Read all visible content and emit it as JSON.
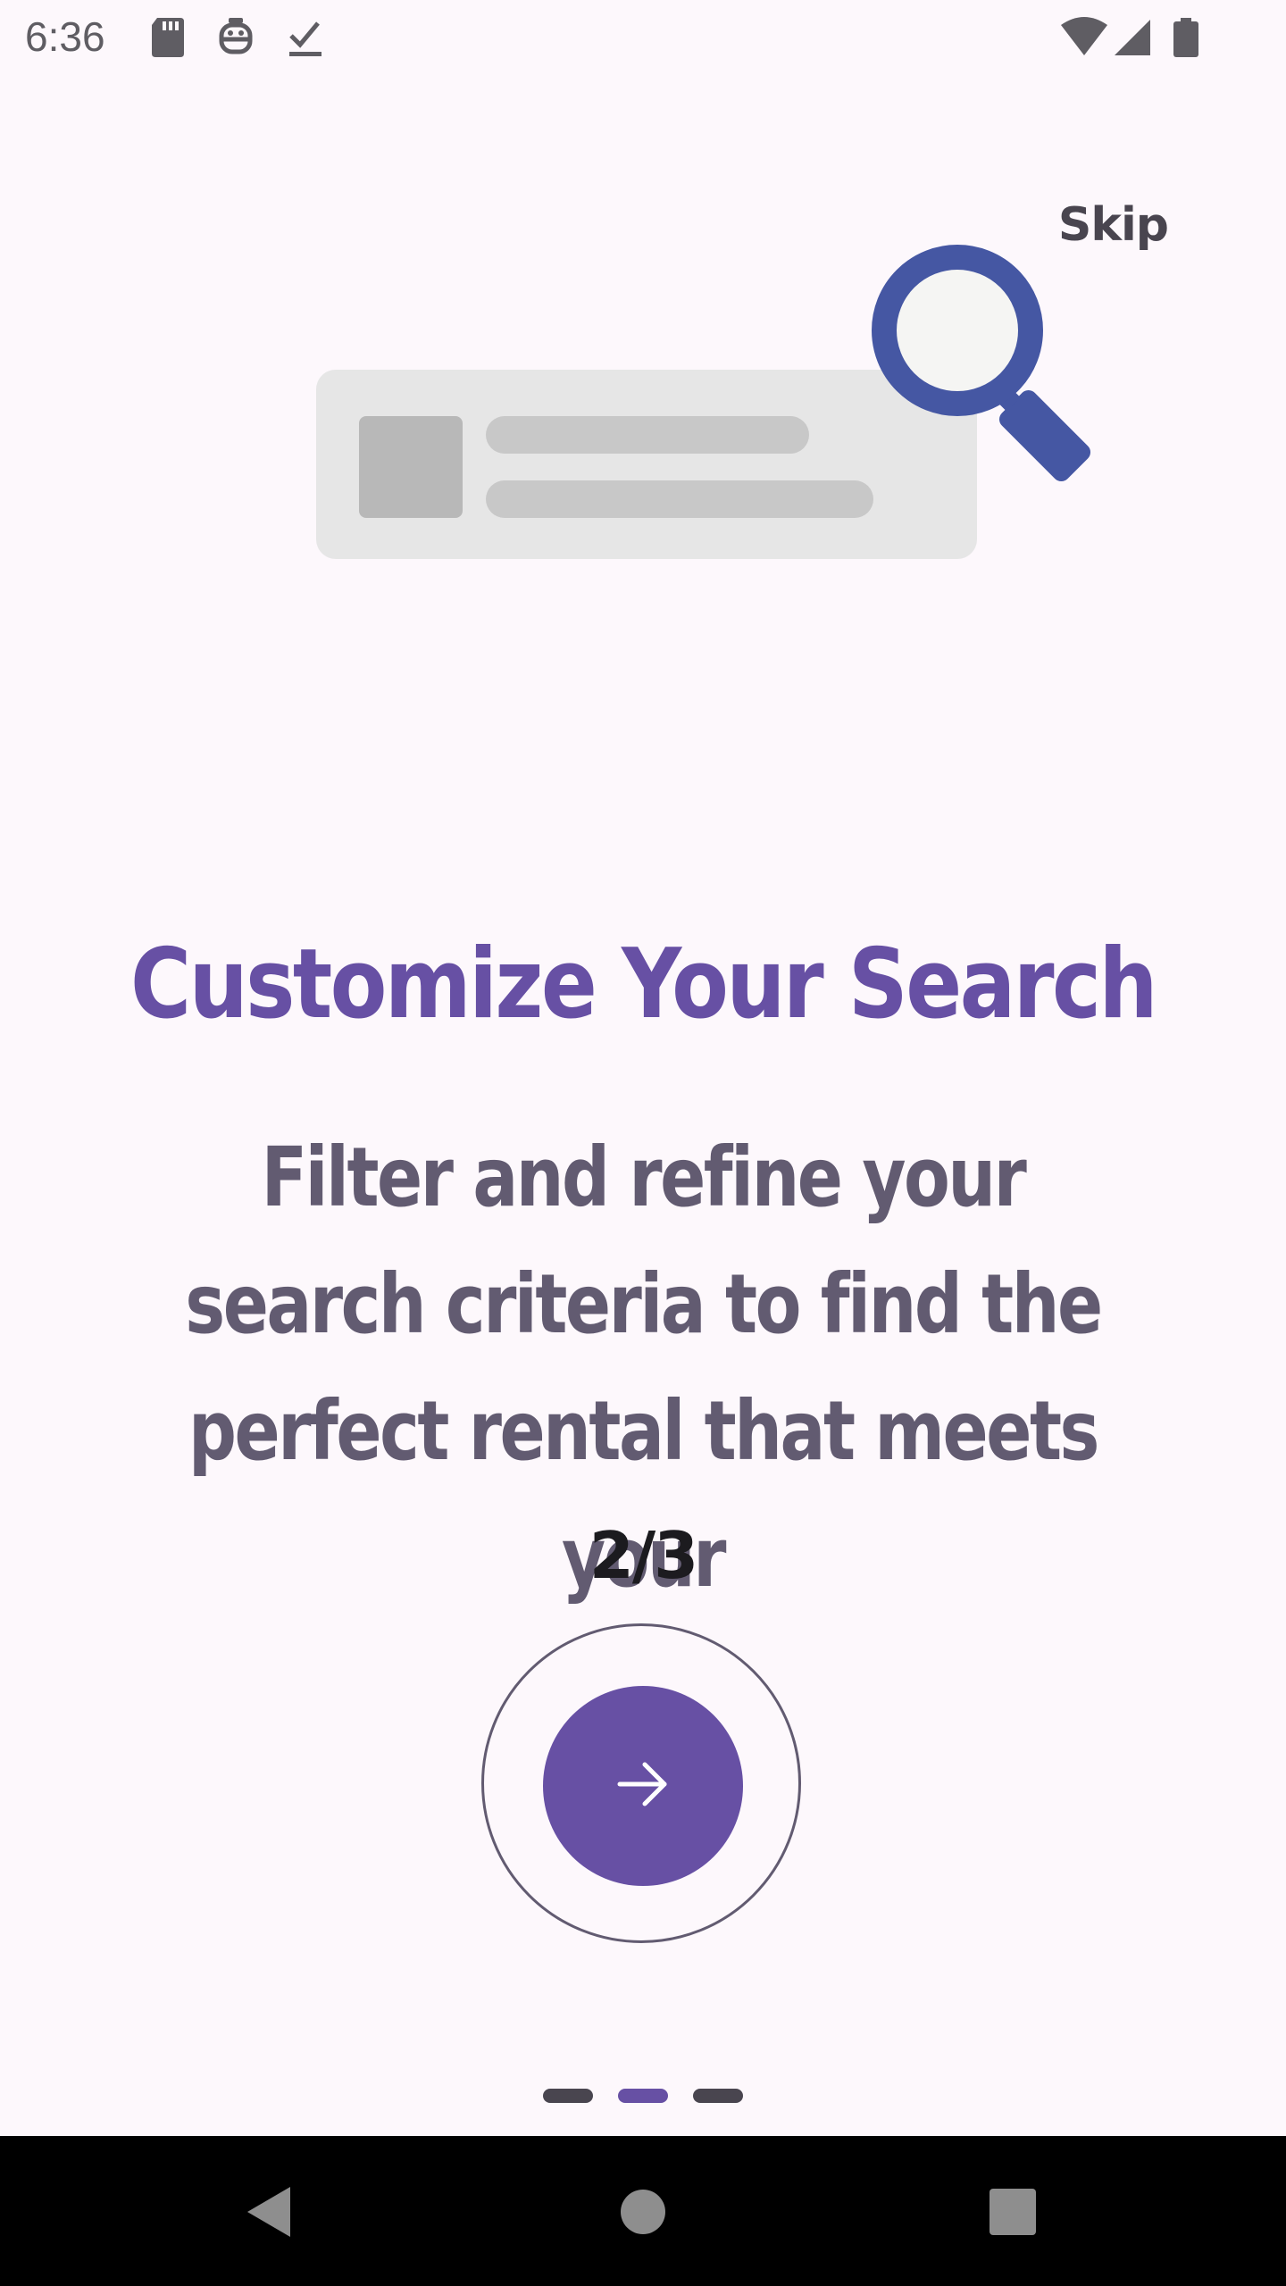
{
  "status_bar": {
    "time": "6:36",
    "icons": [
      "sd-card-icon",
      "accessibility-icon",
      "download-done-icon",
      "wifi-icon",
      "cellular-signal-icon",
      "battery-icon"
    ]
  },
  "onboarding": {
    "skip_label": "Skip",
    "title": "Customize Your Search",
    "description": "Filter and refine your search criteria to find the perfect rental that meets your",
    "page_counter": "2/3",
    "current_page": 2,
    "total_pages": 3,
    "illustration_icon": "search-magnifier-icon",
    "next_icon": "arrow-right-icon"
  },
  "colors": {
    "primary": "#6750a4",
    "title": "#6750a4",
    "description": "#625b71",
    "magnifier": "#4557a3",
    "background": "#fdf8fc"
  },
  "nav_bar": {
    "icons": [
      "back-icon",
      "home-icon",
      "recents-icon"
    ]
  }
}
